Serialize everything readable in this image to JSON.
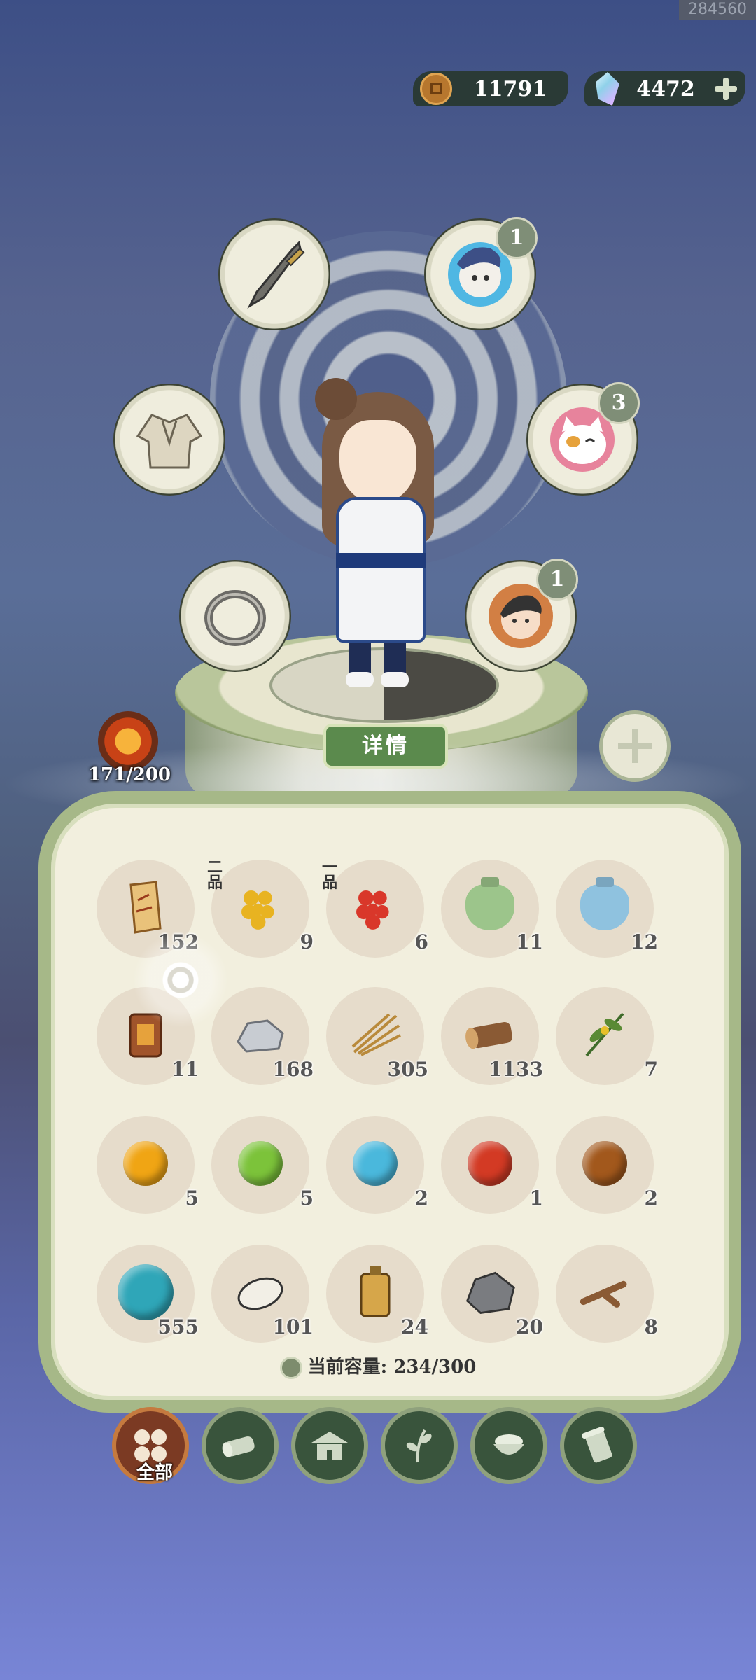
{
  "uid": "284560",
  "currency": {
    "coins": "11791",
    "gems": "4472"
  },
  "equipment": {
    "weapon": "sword-icon",
    "armor": "robe-icon",
    "accessory": "ring-icon",
    "pet1": {
      "icon": "fox-spirit-icon",
      "level": "1"
    },
    "pet2": {
      "icon": "cat-spirit-icon",
      "level": "3"
    },
    "pet3": {
      "icon": "boy-spirit-icon",
      "level": "1"
    }
  },
  "detail_button": "详情",
  "stamina": "171/200",
  "inventory": [
    {
      "icon": "scroll-icon",
      "count": "152",
      "grade": ""
    },
    {
      "icon": "yellow-berries-icon",
      "count": "9",
      "grade": "二品"
    },
    {
      "icon": "red-berries-icon",
      "count": "6",
      "grade": "一品"
    },
    {
      "icon": "green-bag-icon",
      "count": "11",
      "grade": ""
    },
    {
      "icon": "blue-bag-icon",
      "count": "12",
      "grade": ""
    },
    {
      "icon": "token-icon",
      "count": "11",
      "grade": ""
    },
    {
      "icon": "stone-icon",
      "count": "168",
      "grade": ""
    },
    {
      "icon": "straw-icon",
      "count": "305",
      "grade": ""
    },
    {
      "icon": "log-icon",
      "count": "1133",
      "grade": ""
    },
    {
      "icon": "herb-icon",
      "count": "7",
      "grade": ""
    },
    {
      "icon": "gold-orb-icon",
      "count": "5",
      "grade": ""
    },
    {
      "icon": "green-orb-icon",
      "count": "5",
      "grade": ""
    },
    {
      "icon": "blue-orb-icon",
      "count": "2",
      "grade": ""
    },
    {
      "icon": "fire-orb-icon",
      "count": "1",
      "grade": ""
    },
    {
      "icon": "earth-orb-icon",
      "count": "2",
      "grade": ""
    },
    {
      "icon": "water-spirit-icon",
      "count": "555",
      "grade": ""
    },
    {
      "icon": "white-stone-icon",
      "count": "101",
      "grade": ""
    },
    {
      "icon": "pendant-icon",
      "count": "24",
      "grade": ""
    },
    {
      "icon": "ore-icon",
      "count": "20",
      "grade": ""
    },
    {
      "icon": "branch-icon",
      "count": "8",
      "grade": ""
    }
  ],
  "capacity": "当前容量: 234/300",
  "tabs": [
    {
      "icon": "all-icon",
      "label": "全部",
      "active": true
    },
    {
      "icon": "wood-icon",
      "label": ""
    },
    {
      "icon": "house-icon",
      "label": ""
    },
    {
      "icon": "leaf-icon",
      "label": ""
    },
    {
      "icon": "bowl-icon",
      "label": ""
    },
    {
      "icon": "scroll-tab-icon",
      "label": ""
    }
  ]
}
